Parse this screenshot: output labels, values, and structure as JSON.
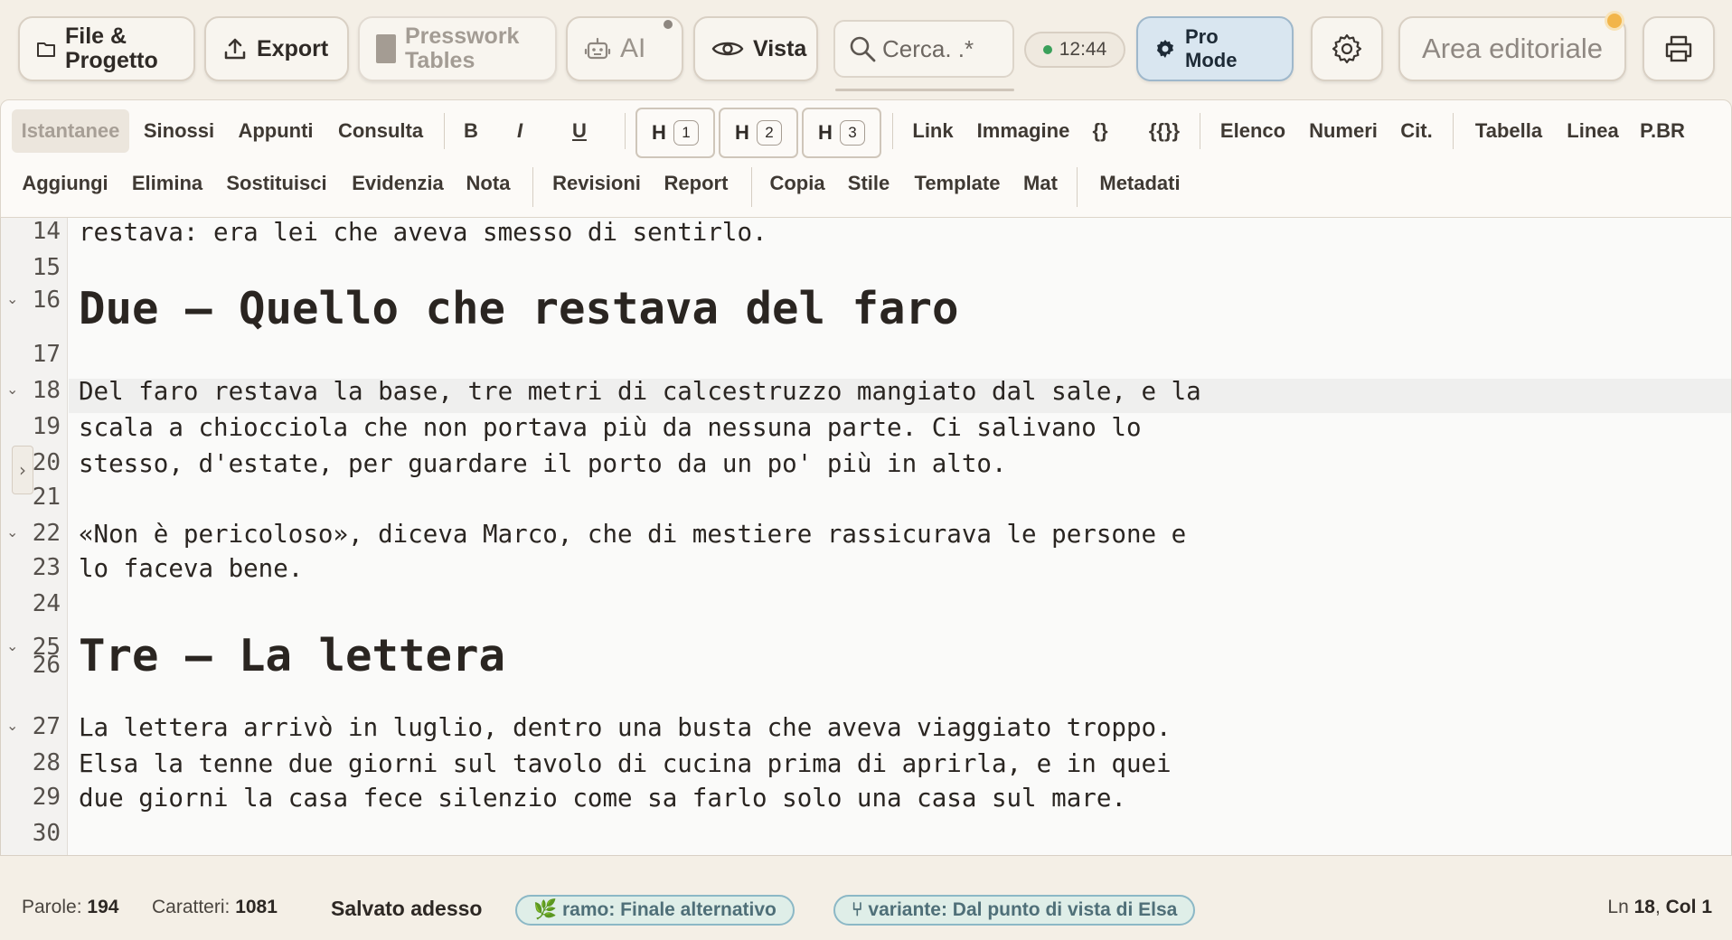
{
  "topbar": {
    "file_line1": "File &",
    "file_line2": "Progetto",
    "export": "Export",
    "presswork_line1": "Presswork",
    "presswork_line2": "Tables",
    "ai": "AI",
    "vista": "Vista",
    "search_placeholder": "Cerca. .*",
    "clock": "12:44",
    "pro_mode": "Pro Mode",
    "area": "Area editoriale"
  },
  "toolbar": {
    "row1": {
      "istantanee": "Istantanee",
      "sinossi": "Sinossi",
      "appunti": "Appunti",
      "consulta": "Consulta",
      "bold": "B",
      "italic": "I",
      "underline": "U",
      "h": "H",
      "h1": "1",
      "h2": "2",
      "h3": "3",
      "link": "Link",
      "immagine": "Immagine",
      "braces": "{}",
      "double_braces": "{{}}",
      "elenco": "Elenco",
      "numeri": "Numeri",
      "cit": "Cit.",
      "tabella": "Tabella",
      "linea": "Linea",
      "pbr": "P.BR"
    },
    "row2": {
      "aggiungi": "Aggiungi",
      "elimina": "Elimina",
      "sostituisci": "Sostituisci",
      "evidenzia": "Evidenzia",
      "nota": "Nota",
      "revisioni": "Revisioni",
      "report": "Report",
      "copia": "Copia",
      "stile": "Stile",
      "template": "Template",
      "mat": "Mat",
      "metadati": "Metadati"
    }
  },
  "editor": {
    "lines": [
      {
        "n": "14",
        "text": "restava: era lei che aveva smesso di sentirlo."
      },
      {
        "n": "15",
        "text": ""
      },
      {
        "n": "16",
        "text": "Due — Quello che restava del faro"
      },
      {
        "n": "17",
        "text": ""
      },
      {
        "n": "18",
        "text": "Del faro restava la base, tre metri di calcestruzzo mangiato dal sale, e la"
      },
      {
        "n": "19",
        "text": "scala a chiocciola che non portava più da nessuna parte. Ci salivano lo"
      },
      {
        "n": "20",
        "text": "stesso, d'estate, per guardare il porto da un po' più in alto."
      },
      {
        "n": "21",
        "text": ""
      },
      {
        "n": "22",
        "text": "«Non è pericoloso», diceva Marco, che di mestiere rassicurava le persone e"
      },
      {
        "n": "23",
        "text": "lo faceva bene."
      },
      {
        "n": "24",
        "text": ""
      },
      {
        "n": "25",
        "text": "Tre — La lettera"
      },
      {
        "n": "26",
        "text": ""
      },
      {
        "n": "27",
        "text": "La lettera arrivò in luglio, dentro una busta che aveva viaggiato troppo."
      },
      {
        "n": "28",
        "text": "Elsa la tenne due giorni sul tavolo di cucina prima di aprirla, e in quei"
      },
      {
        "n": "29",
        "text": "due giorni la casa fece silenzio come sa farlo solo una casa sul mare."
      },
      {
        "n": "30",
        "text": ""
      }
    ]
  },
  "status": {
    "words_label": "Parole:",
    "words": "194",
    "chars_label": "Caratteri:",
    "chars": "1081",
    "saved": "Salvato adesso",
    "branch": "🌿 ramo: Finale alternativo",
    "variant": "⑂ variante: Dal punto di vista di Elsa",
    "ln_label": "Ln",
    "ln": "18",
    "col_label": "Col",
    "col": "1"
  },
  "icons": [
    "folder-icon",
    "export-icon",
    "presswork-icon",
    "robot-icon",
    "eye-icon",
    "search-icon",
    "gear-icon",
    "printer-icon",
    "fold-chevron-icon",
    "gutter-toggle-icon"
  ],
  "colors": {
    "background": "#f4efe6",
    "pro_mode": "#d9e6f0",
    "pill": "#dfeee8",
    "notification": "#f2b54a"
  }
}
